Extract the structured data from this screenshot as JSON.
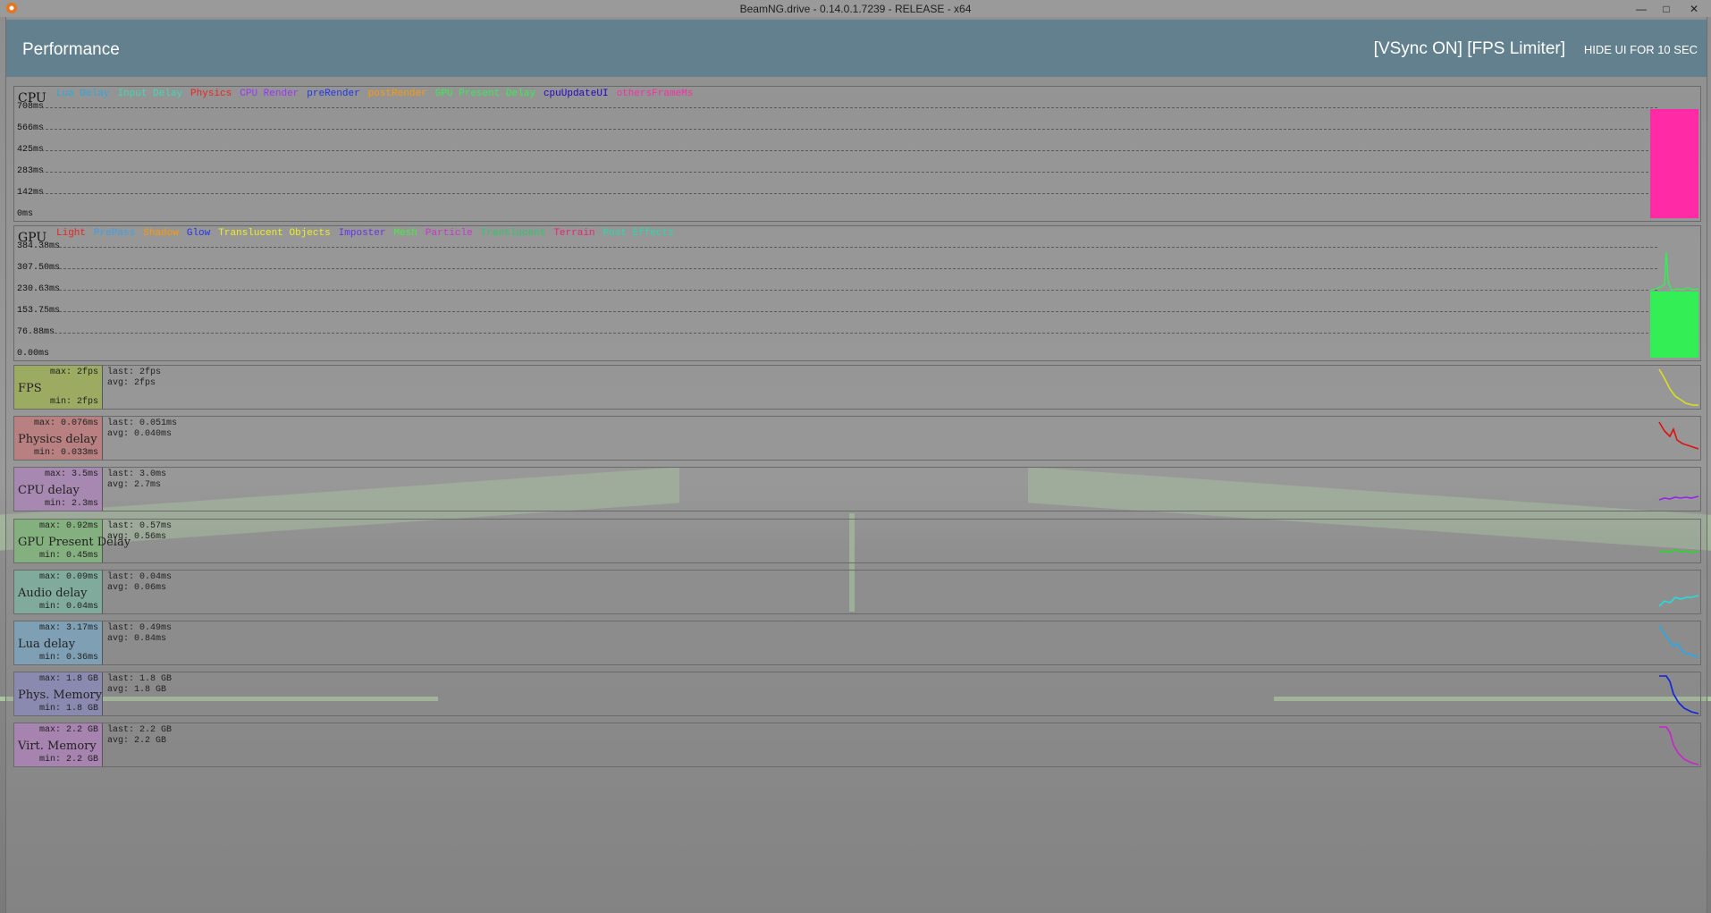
{
  "window": {
    "title": "BeamNG.drive - 0.14.0.1.7239 - RELEASE - x64",
    "minimize_glyph": "—",
    "maximize_glyph": "□",
    "close_glyph": "✕"
  },
  "panel": {
    "title": "Performance",
    "vsync_label": "[VSync ON]  [FPS Limiter]",
    "hide_ui_label": "HIDE UI FOR 10 SEC"
  },
  "cpu_graph": {
    "name": "CPU",
    "legend": [
      {
        "label": "Lua Delay",
        "color": "#2aa8e0"
      },
      {
        "label": "Input Delay",
        "color": "#3dd9b5"
      },
      {
        "label": "Physics",
        "color": "#ee2222"
      },
      {
        "label": "CPU Render",
        "color": "#9b33ff"
      },
      {
        "label": "preRender",
        "color": "#2233ee"
      },
      {
        "label": "postRender",
        "color": "#ff9900"
      },
      {
        "label": "GPU Present Delay",
        "color": "#33ee55"
      },
      {
        "label": "cpuUpdateUI",
        "color": "#2200cc"
      },
      {
        "label": "othersFrameMs",
        "color": "#ff2ba6"
      }
    ],
    "yticks": [
      "708ms",
      "566ms",
      "425ms",
      "283ms",
      "142ms",
      "0ms"
    ]
  },
  "gpu_graph": {
    "name": "GPU",
    "legend": [
      {
        "label": "Light",
        "color": "#ee2222"
      },
      {
        "label": "PrePass",
        "color": "#3aa0ee"
      },
      {
        "label": "Shadow",
        "color": "#ff9900"
      },
      {
        "label": "Glow",
        "color": "#2233ee"
      },
      {
        "label": "Translucent Objects",
        "color": "#eeee22"
      },
      {
        "label": "Imposter",
        "color": "#6633ee"
      },
      {
        "label": "Mesh",
        "color": "#44ee44"
      },
      {
        "label": "Particle",
        "color": "#cc33cc"
      },
      {
        "label": "Translucent",
        "color": "#22cc66"
      },
      {
        "label": "Terrain",
        "color": "#ee2277"
      },
      {
        "label": "Post Effects",
        "color": "#22ddaa"
      }
    ],
    "yticks": [
      "384.38ms",
      "307.50ms",
      "230.63ms",
      "153.75ms",
      "76.88ms",
      "0.00ms"
    ]
  },
  "metrics": [
    {
      "name": "FPS",
      "max": "max: 2fps",
      "min": "min: 2fps",
      "last": "last: 2fps",
      "avg": "avg: 2fps",
      "bg": "#9bab62",
      "line": "#dddd22"
    },
    {
      "name": "Physics delay",
      "max": "max: 0.076ms",
      "min": "min: 0.033ms",
      "last": "last: 0.051ms",
      "avg": "avg: 0.040ms",
      "bg": "#b88080",
      "line": "#dd1111"
    },
    {
      "name": "CPU delay",
      "max": "max: 3.5ms",
      "min": "min: 2.3ms",
      "last": "last: 3.0ms",
      "avg": "avg: 2.7ms",
      "bg": "#a788b0",
      "line": "#9922ee"
    },
    {
      "name": "GPU Present Delay",
      "max": "max: 0.92ms",
      "min": "min: 0.45ms",
      "last": "last: 0.57ms",
      "avg": "avg: 0.56ms",
      "bg": "#83b07e",
      "line": "#22dd22"
    },
    {
      "name": "Audio delay",
      "max": "max: 0.09ms",
      "min": "min: 0.04ms",
      "last": "last: 0.04ms",
      "avg": "avg: 0.06ms",
      "bg": "#80ab9c",
      "line": "#22dddd"
    },
    {
      "name": "Lua delay",
      "max": "max: 3.17ms",
      "min": "min: 0.36ms",
      "last": "last: 0.49ms",
      "avg": "avg: 0.84ms",
      "bg": "#7fa0b4",
      "line": "#22aaee"
    },
    {
      "name": "Phys. Memory",
      "max": "max: 1.8 GB",
      "min": "min: 1.8 GB",
      "last": "last: 1.8 GB",
      "avg": "avg: 1.8 GB",
      "bg": "#8a8ab0",
      "line": "#1122dd"
    },
    {
      "name": "Virt. Memory",
      "max": "max: 2.2 GB",
      "min": "min: 2.2 GB",
      "last": "last: 2.2 GB",
      "avg": "avg: 2.2 GB",
      "bg": "#a784b0",
      "line": "#cc22cc"
    }
  ]
}
